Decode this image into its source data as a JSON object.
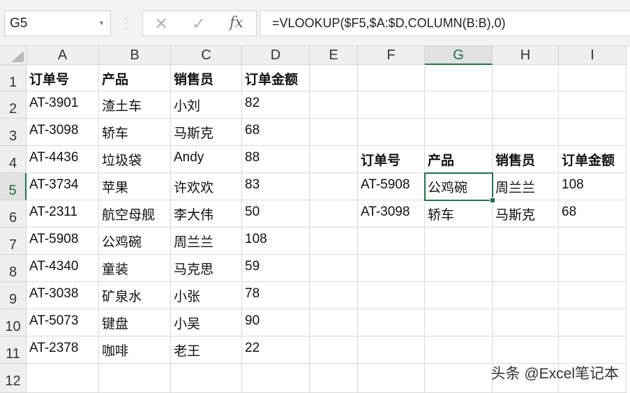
{
  "name_box": "G5",
  "formula": "=VLOOKUP($F5,$A:$D,COLUMN(B:B),0)",
  "formula_buttons": {
    "cancel": "✕",
    "enter": "✓",
    "fx": "fx"
  },
  "columns": [
    "A",
    "B",
    "C",
    "D",
    "E",
    "F",
    "G",
    "H",
    "I"
  ],
  "rows": [
    "1",
    "2",
    "3",
    "4",
    "5",
    "6",
    "7",
    "8",
    "9",
    "10",
    "11",
    "12"
  ],
  "selected": {
    "col": "G",
    "row": "5"
  },
  "cells": [
    [
      "订单号",
      "产品",
      "销售员",
      "订单金额",
      "",
      "",
      "",
      "",
      ""
    ],
    [
      "AT-3901",
      "渣土车",
      "小刘",
      "82",
      "",
      "",
      "",
      "",
      ""
    ],
    [
      "AT-3098",
      "轿车",
      "马斯克",
      "68",
      "",
      "",
      "",
      "",
      ""
    ],
    [
      "AT-4436",
      "垃圾袋",
      "Andy",
      "88",
      "",
      "订单号",
      "产品",
      "销售员",
      "订单金额"
    ],
    [
      "AT-3734",
      "苹果",
      "许欢欢",
      "83",
      "",
      "AT-5908",
      "公鸡碗",
      "周兰兰",
      "108"
    ],
    [
      "AT-2311",
      "航空母舰",
      "李大伟",
      "50",
      "",
      "AT-3098",
      "轿车",
      "马斯克",
      "68"
    ],
    [
      "AT-5908",
      "公鸡碗",
      "周兰兰",
      "108",
      "",
      "",
      "",
      "",
      ""
    ],
    [
      "AT-4340",
      "童装",
      "马克思",
      "59",
      "",
      "",
      "",
      "",
      ""
    ],
    [
      "AT-3038",
      "矿泉水",
      "小张",
      "78",
      "",
      "",
      "",
      "",
      ""
    ],
    [
      "AT-5073",
      "键盘",
      "小吴",
      "90",
      "",
      "",
      "",
      "",
      ""
    ],
    [
      "AT-2378",
      "咖啡",
      "老王",
      "22",
      "",
      "",
      "",
      "",
      ""
    ],
    [
      "",
      "",
      "",
      "",
      "",
      "",
      "",
      "",
      ""
    ]
  ],
  "watermark": "头条 @Excel笔记本"
}
